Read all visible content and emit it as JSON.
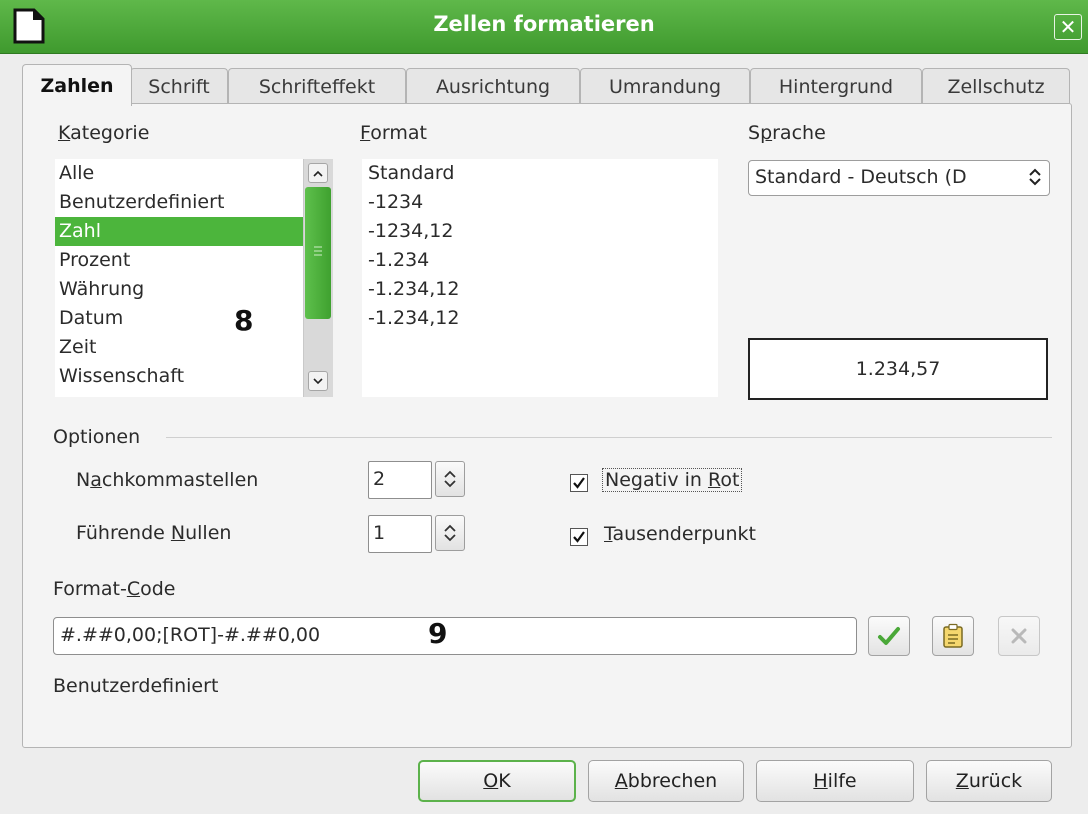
{
  "window": {
    "title": "Zellen formatieren",
    "close_glyph": "✕"
  },
  "tabs": [
    {
      "label": "Zahlen",
      "active": true
    },
    {
      "label": "Schrift",
      "active": false
    },
    {
      "label": "Schrifteffekt",
      "active": false
    },
    {
      "label": "Ausrichtung",
      "active": false
    },
    {
      "label": "Umrandung",
      "active": false
    },
    {
      "label": "Hintergrund",
      "active": false
    },
    {
      "label": "Zellschutz",
      "active": false
    }
  ],
  "kategorie": {
    "label_first": "K",
    "label_rest": "ategorie",
    "items": [
      "Alle",
      "Benutzerdefiniert",
      "Zahl",
      "Prozent",
      "Währung",
      "Datum",
      "Zeit",
      "Wissenschaft"
    ],
    "selected": "Zahl",
    "marker": "8"
  },
  "format": {
    "label_first": "F",
    "label_rest": "ormat",
    "items": [
      "Standard",
      "-1234",
      "-1234,12",
      "-1.234",
      "-1.234,12",
      "-1.234,12"
    ]
  },
  "sprache": {
    "label_pre": "S",
    "label_u": "p",
    "label_rest": "rache",
    "value": "Standard - Deutsch (D"
  },
  "preview": {
    "value": "1.234,57"
  },
  "optionen": {
    "label": "Optionen",
    "nachkommastellen": {
      "pre": "N",
      "u": "a",
      "rest": "chkommastellen",
      "value": "2"
    },
    "fuehrende_nullen": {
      "pre": "Führende ",
      "u": "N",
      "rest": "ullen",
      "value": "1"
    },
    "negativ_in_rot": {
      "pre": "Negativ in ",
      "u": "R",
      "rest": "ot",
      "checked": true
    },
    "tausenderpunkt": {
      "pre": "",
      "u": "T",
      "rest": "ausenderpunkt",
      "checked": true
    }
  },
  "format_code": {
    "label_pre": "Format-",
    "label_u": "C",
    "label_rest": "ode",
    "value": "#.##0,00;[ROT]-#.##0,00",
    "marker": "9",
    "description": "Benutzerdefiniert"
  },
  "buttons": {
    "ok": {
      "u": "O",
      "rest": "K"
    },
    "cancel": {
      "u": "A",
      "rest": "bbrechen"
    },
    "help": {
      "u": "H",
      "rest": "ilfe"
    },
    "back": {
      "u": "Z",
      "rest": "urück"
    }
  },
  "colors": {
    "accent_green": "#4cb53c",
    "titlebar_green": "#4aa838"
  }
}
